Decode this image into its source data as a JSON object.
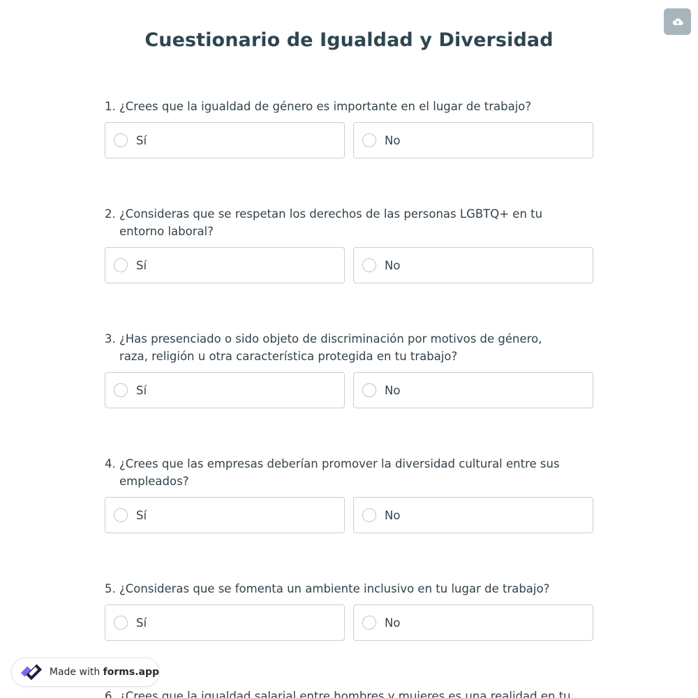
{
  "form": {
    "title": "Cuestionario de Igualdad y Diversidad"
  },
  "toolbar": {
    "save_icon": "cloud-upload-icon"
  },
  "questions": [
    {
      "number": "1.",
      "text": "¿Crees que la igualdad de género es importante en el lugar de trabajo?",
      "options": [
        "Sí",
        "No"
      ]
    },
    {
      "number": "2.",
      "text": "¿Consideras que se respetan los derechos de las personas LGBTQ+ en tu entorno laboral?",
      "options": [
        "Sí",
        "No"
      ]
    },
    {
      "number": "3.",
      "text": "¿Has presenciado o sido objeto de discriminación por motivos de género, raza, religión u otra característica protegida en tu trabajo?",
      "options": [
        "Sí",
        "No"
      ]
    },
    {
      "number": "4.",
      "text": "¿Crees que las empresas deberían promover la diversidad cultural entre sus empleados?",
      "options": [
        "Sí",
        "No"
      ]
    },
    {
      "number": "5.",
      "text": "¿Consideras que se fomenta un ambiente inclusivo en tu lugar de trabajo?",
      "options": [
        "Sí",
        "No"
      ]
    },
    {
      "number": "6.",
      "text": "¿Crees que la igualdad salarial entre hombres y mujeres es una realidad en tu",
      "options": []
    }
  ],
  "badge": {
    "prefix": "Made with",
    "brand": "forms.app"
  },
  "colors": {
    "title": "#2e4650",
    "text": "#33424b",
    "border": "#c9cfd3",
    "save_button": "#a9b5bc",
    "logo_purple": "#7a6cf0",
    "logo_dark": "#1f1f3a"
  }
}
